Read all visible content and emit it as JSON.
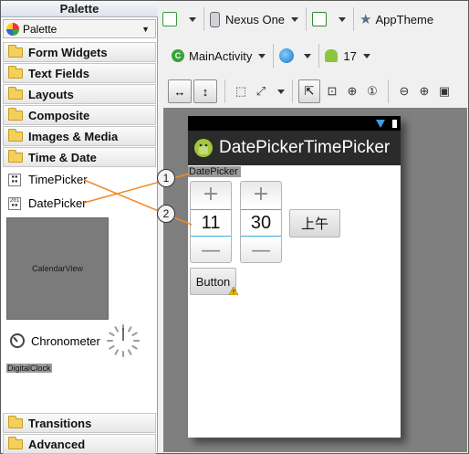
{
  "palette": {
    "title": "Palette",
    "selector_label": "Palette",
    "categories": [
      "Form Widgets",
      "Text Fields",
      "Layouts",
      "Composite",
      "Images & Media",
      "Time & Date"
    ],
    "widgets": {
      "timepicker": "TimePicker",
      "datepicker": "DatePicker",
      "calendarview": "CalendarView",
      "chronometer": "Chronometer",
      "digitalclock": "DigitalClock"
    },
    "bottom_categories": [
      "Transitions",
      "Advanced"
    ]
  },
  "toolbar": {
    "device": "Nexus One",
    "theme": "AppTheme",
    "activity": "MainActivity",
    "api_level": "17"
  },
  "device": {
    "app_title": "DatePickerTimePicker",
    "datepicker_label": "DatePicker",
    "hour_value": "11",
    "minute_value": "30",
    "plus_symbol": "+",
    "minus_symbol": "—",
    "ampm_label": "上午",
    "button_label": "Button"
  },
  "callouts": {
    "one": "1",
    "two": "2"
  },
  "colors": {
    "annotation_line": "#f08a24",
    "canvas_bg": "#7f7f7f",
    "spinner_divider": "#3daee0",
    "folder": "#f3cf5c"
  }
}
